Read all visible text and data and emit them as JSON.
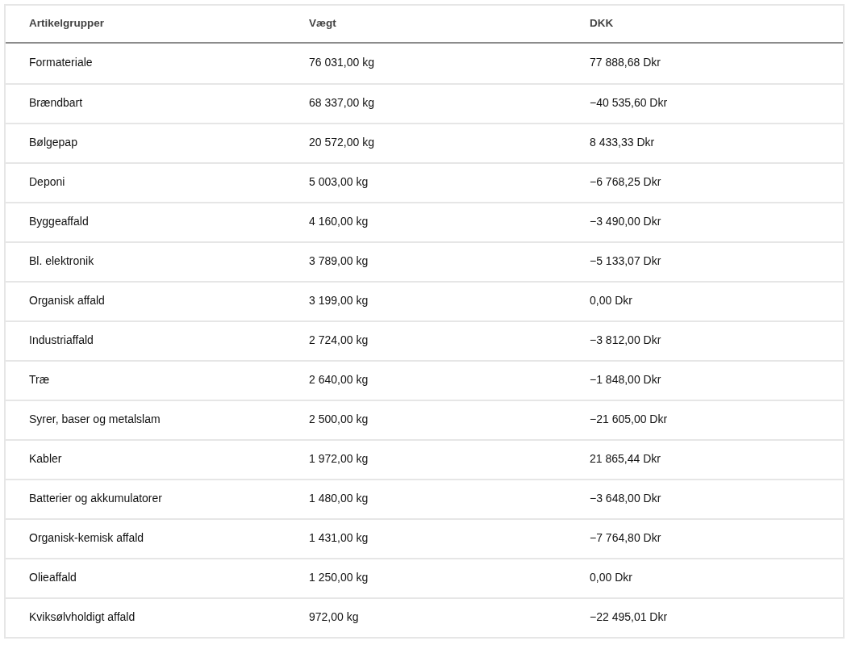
{
  "table": {
    "columns": [
      "Artikelgrupper",
      "Vægt",
      "DKK"
    ],
    "rows": [
      [
        "Formateriale",
        "76 031,00 kg",
        "77 888,68 Dkr"
      ],
      [
        "Brændbart",
        "68 337,00 kg",
        "−40 535,60 Dkr"
      ],
      [
        "Bølgepap",
        "20 572,00 kg",
        "8 433,33 Dkr"
      ],
      [
        "Deponi",
        "5 003,00 kg",
        "−6 768,25 Dkr"
      ],
      [
        "Byggeaffald",
        "4 160,00 kg",
        "−3 490,00 Dkr"
      ],
      [
        "Bl. elektronik",
        "3 789,00 kg",
        "−5 133,07 Dkr"
      ],
      [
        "Organisk affald",
        "3 199,00 kg",
        "0,00 Dkr"
      ],
      [
        "Industriaffald",
        "2 724,00 kg",
        "−3 812,00 Dkr"
      ],
      [
        "Træ",
        "2 640,00 kg",
        "−1 848,00 Dkr"
      ],
      [
        "Syrer, baser og metalslam",
        "2 500,00 kg",
        "−21 605,00 Dkr"
      ],
      [
        "Kabler",
        "1 972,00 kg",
        "21 865,44 Dkr"
      ],
      [
        "Batterier og akkumulatorer",
        "1 480,00 kg",
        "−3 648,00 Dkr"
      ],
      [
        "Organisk-kemisk affald",
        "1 431,00 kg",
        "−7 764,80 Dkr"
      ],
      [
        "Olieaffald",
        "1 250,00 kg",
        "0,00 Dkr"
      ],
      [
        "Kviksølvholdigt affald",
        "972,00 kg",
        "−22 495,01 Dkr"
      ]
    ]
  }
}
